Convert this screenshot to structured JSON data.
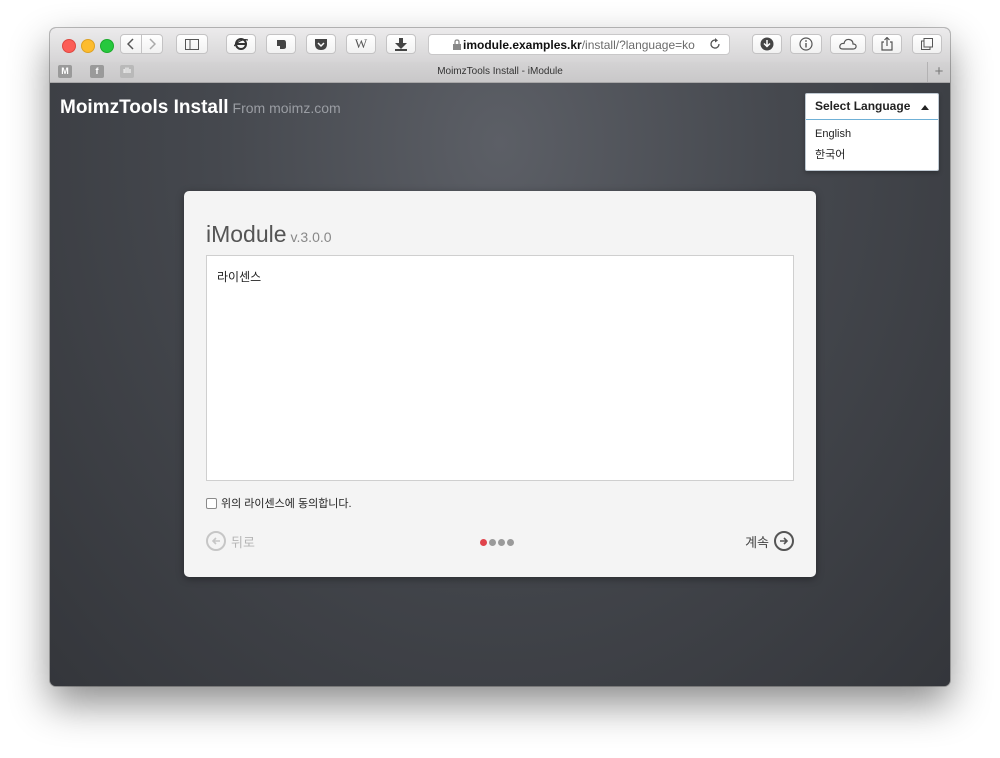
{
  "browser": {
    "address": {
      "host": "imodule.examples.kr",
      "path": "/install/?language=ko"
    },
    "tab_title": "MoimzTools Install - iModule",
    "pinned_tabs": [
      "M",
      "f",
      "ıllı"
    ],
    "new_tab": "+"
  },
  "header": {
    "brand": "MoimzTools Install",
    "brand_sub": "From moimz.com"
  },
  "language_menu": {
    "label": "Select Language",
    "options": [
      "English",
      "한국어"
    ]
  },
  "panel": {
    "title": "iModule",
    "version": "v.3.0.0",
    "license_text": "라이센스",
    "agree_label": "위의 라이센스에 동의합니다.",
    "agree_checked": false,
    "back_label": "뒤로",
    "next_label": "계속",
    "steps_total": 4,
    "steps_current": 1
  },
  "colors": {
    "accent_step": "#e0434b"
  }
}
